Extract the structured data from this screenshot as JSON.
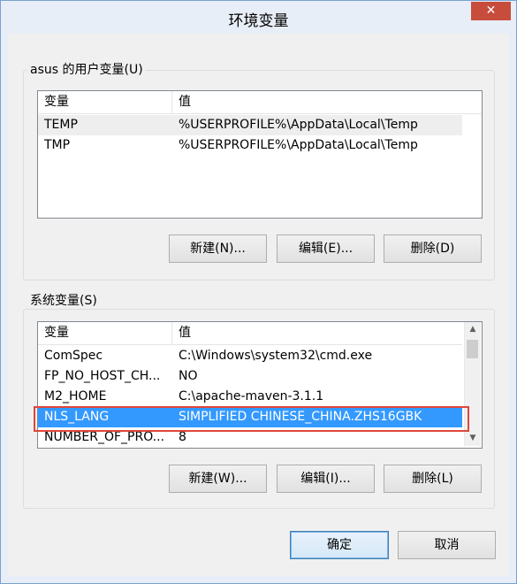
{
  "window": {
    "title": "环境变量",
    "close_glyph": "✕"
  },
  "user_vars": {
    "group_label": "asus 的用户变量(U)",
    "columns": [
      "变量",
      "值"
    ],
    "rows": [
      {
        "name": "TEMP",
        "value": "%USERPROFILE%\\AppData\\Local\\Temp"
      },
      {
        "name": "TMP",
        "value": "%USERPROFILE%\\AppData\\Local\\Temp"
      }
    ],
    "buttons": {
      "new": "新建(N)...",
      "edit": "编辑(E)...",
      "delete": "删除(D)"
    }
  },
  "system_vars": {
    "group_label": "系统变量(S)",
    "columns": [
      "变量",
      "值"
    ],
    "rows": [
      {
        "name": "ComSpec",
        "value": "C:\\Windows\\system32\\cmd.exe"
      },
      {
        "name": "FP_NO_HOST_CH...",
        "value": "NO"
      },
      {
        "name": "M2_HOME",
        "value": "C:\\apache-maven-3.1.1"
      },
      {
        "name": "NLS_LANG",
        "value": "SIMPLIFIED CHINESE_CHINA.ZHS16GBK"
      },
      {
        "name": "NUMBER_OF_PRO...",
        "value": "8"
      }
    ],
    "selected_row": "NLS_LANG",
    "buttons": {
      "new": "新建(W)...",
      "edit": "编辑(I)...",
      "delete": "删除(L)"
    }
  },
  "footer": {
    "ok": "确定",
    "cancel": "取消"
  },
  "colors": {
    "selection": "#3399ff",
    "highlight_border": "#e0463a",
    "close_button": "#c74c3c"
  }
}
